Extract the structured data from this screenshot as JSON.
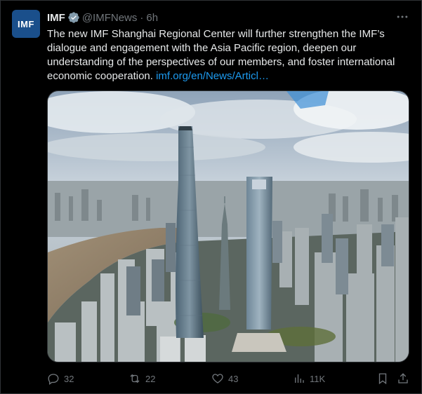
{
  "author": {
    "avatar_text": "IMF",
    "name": "IMF",
    "handle": "@IMFNews",
    "separator": "·",
    "time": "6h",
    "verified_color": "#829aab"
  },
  "tweet": {
    "body": "The new IMF Shanghai Regional Center will further strengthen the IMF’s dialogue and engagement with the Asia Pacific region, deepen our understanding of the perspectives of our members, and foster international economic cooperation. ",
    "link": "imf.org/en/News/Articl…"
  },
  "media": {
    "description_icon": "photo"
  },
  "actions": {
    "replies": "32",
    "retweets": "22",
    "likes": "43",
    "views": "11K"
  },
  "colors": {
    "link": "#1d9bf0",
    "muted": "#71767b",
    "avatar_bg": "#1a4f8b"
  }
}
